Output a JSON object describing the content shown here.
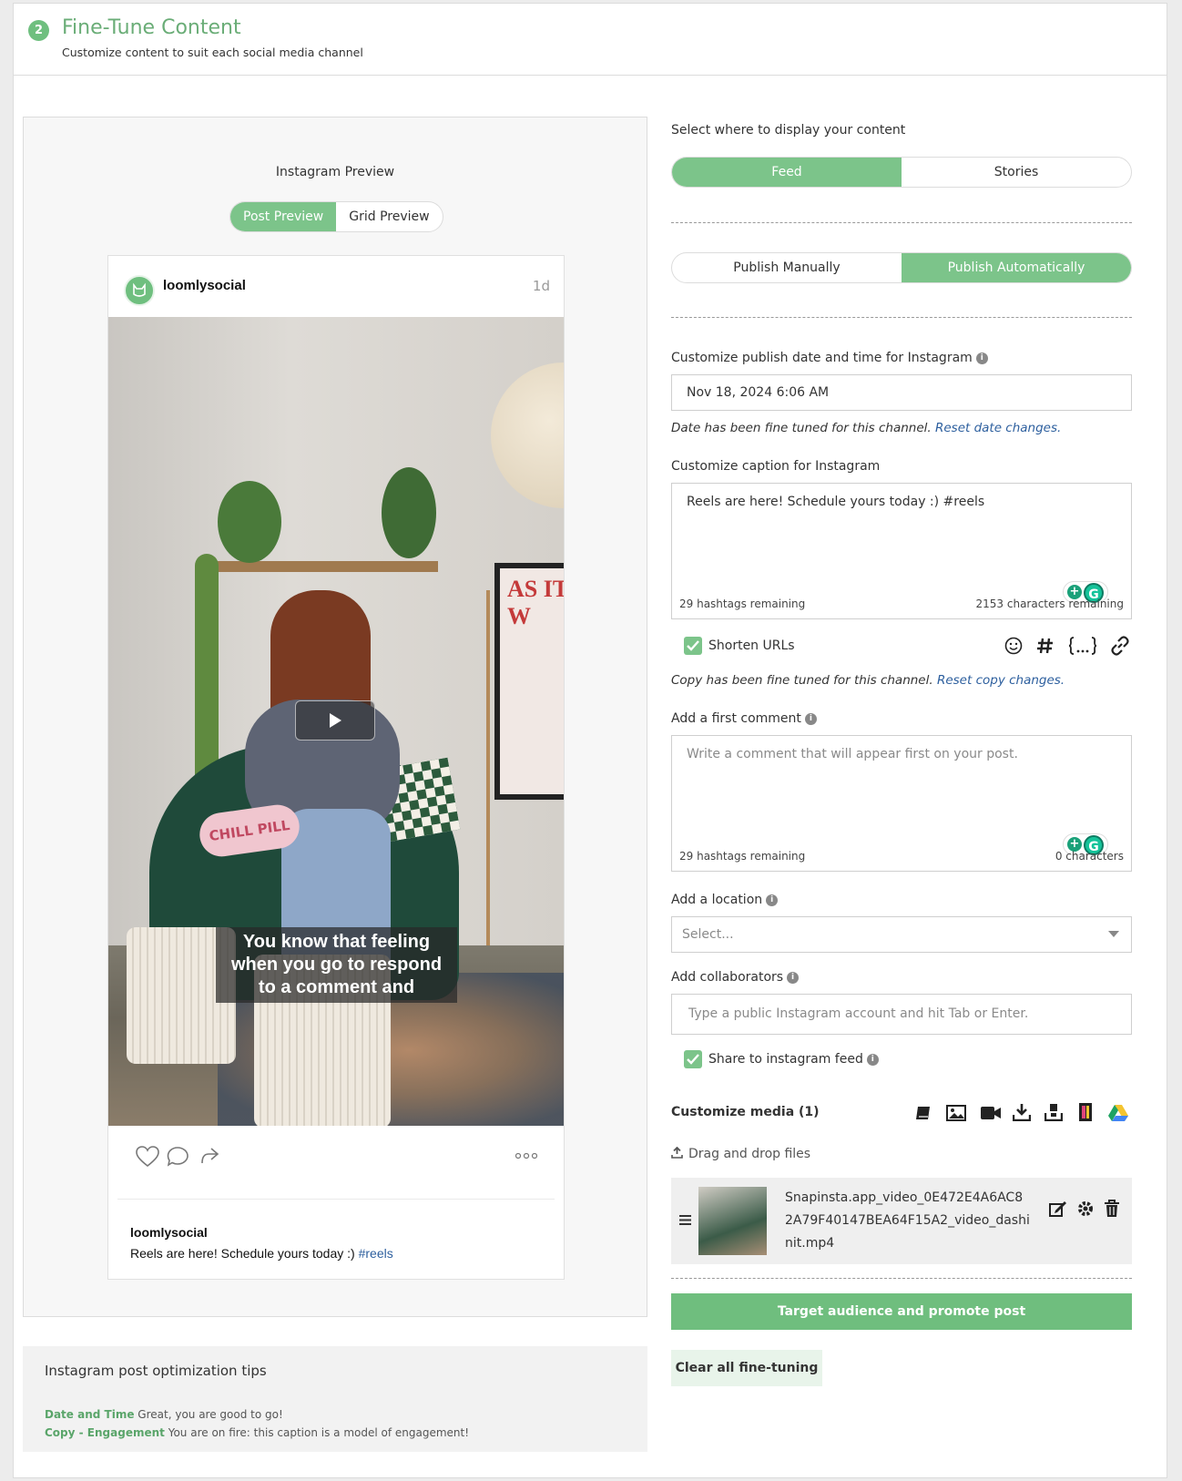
{
  "header": {
    "step_number": "2",
    "title": "Fine-Tune Content",
    "subtitle": "Customize content to suit each social media channel"
  },
  "preview": {
    "title": "Instagram Preview",
    "tabs": [
      "Post Preview",
      "Grid Preview"
    ],
    "active_tab": "Post Preview",
    "post": {
      "username": "loomlysocial",
      "time": "1d",
      "overlay_text": [
        "You know that feeling",
        "when you go to respond",
        "to a comment and"
      ],
      "pillow_text": "CHILL PILL",
      "poster_text": "AS IT W",
      "caption_user": "loomlysocial",
      "caption_text": "Reels are here! Schedule yours today :) ",
      "caption_tag": "#reels"
    }
  },
  "tips": {
    "title": "Instagram post optimization tips",
    "items": [
      {
        "key": "Date and Time",
        "text": "Great, you are good to go!"
      },
      {
        "key": "Copy - Engagement",
        "text": "You are on fire: this caption is a model of engagement!"
      }
    ]
  },
  "settings": {
    "display_label": "Select where to display your content",
    "display_options": [
      "Feed",
      "Stories"
    ],
    "display_active": "Feed",
    "publish_options": [
      "Publish Manually",
      "Publish Automatically"
    ],
    "publish_active": "Publish Automatically",
    "date_label": "Customize publish date and time for Instagram",
    "date_value": "Nov 18, 2024 6:06 AM",
    "date_note": "Date has been fine tuned for this channel. ",
    "date_reset": "Reset date changes.",
    "caption_label": "Customize caption for Instagram",
    "caption_value": "Reels are here! Schedule yours today :)  #reels",
    "caption_hashtags": "29 hashtags remaining",
    "caption_chars": "2153 characters remaining",
    "shorten_label": "Shorten URLs",
    "shorten_checked": true,
    "copy_note": "Copy has been fine tuned for this channel. ",
    "copy_reset": "Reset copy changes.",
    "comment_label": "Add a first comment",
    "comment_placeholder": "Write a comment that will appear first on your post.",
    "comment_hashtags": "29 hashtags remaining",
    "comment_chars": "0 characters",
    "location_label": "Add a location",
    "location_placeholder": "Select...",
    "collab_label": "Add collaborators",
    "collab_placeholder": "Type a public Instagram account and hit Tab or Enter.",
    "share_label": "Share to instagram feed",
    "share_checked": true,
    "media_label": "Customize media (1)",
    "drag_label": "Drag and drop files",
    "media_file": "Snapinsta.app_video_0E472E4A6AC82A79F40147BEA64F15A2_video_dashinit.mp4",
    "target_button": "Target audience and promote post",
    "clear_button": "Clear all fine-tuning"
  },
  "colors": {
    "accent": "#7cc48a",
    "accent_dark": "#6aad77",
    "link": "#2d5f9e"
  }
}
